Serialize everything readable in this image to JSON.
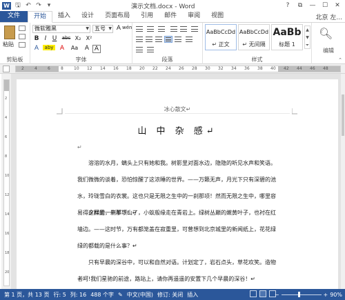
{
  "titlebar": {
    "app_icon": "W",
    "title": "演示文档.docx - Word",
    "qat": [
      "save-icon",
      "undo-icon",
      "redo-icon",
      "customize-icon"
    ],
    "controls": [
      "?",
      "⧉",
      "—",
      "☐",
      "✕"
    ]
  },
  "tabs": {
    "file": "文件",
    "items": [
      "开始",
      "插入",
      "设计",
      "页面布局",
      "引用",
      "邮件",
      "审阅",
      "视图"
    ],
    "active": "开始",
    "user": "北京 左..."
  },
  "ribbon": {
    "clipboard": {
      "paste": "粘贴",
      "label": "剪贴板"
    },
    "font": {
      "name": "微软雅黑",
      "size": "五号",
      "wen_button": "wén",
      "a_button": "A",
      "buttons_row2": [
        "B",
        "I",
        "U",
        "abc",
        "X₂",
        "X²"
      ],
      "buttons_row3": [
        "A",
        "aby",
        "A",
        "Aa",
        "A",
        "A"
      ],
      "label": "字体"
    },
    "paragraph": {
      "label": "段落"
    },
    "styles": {
      "items": [
        {
          "sample": "AaBbCcDd",
          "name": "↵ 正文"
        },
        {
          "sample": "AaBbCcDd",
          "name": "↵ 无间隔"
        },
        {
          "sample": "AaBb",
          "name": "标题 1"
        }
      ],
      "label": "样式"
    },
    "editing": {
      "label": "编辑"
    }
  },
  "ruler": {
    "numbers": [
      "2",
      "4",
      "6",
      "8",
      "10",
      "12",
      "14",
      "16",
      "18",
      "20",
      "22",
      "24",
      "26",
      "28",
      "30",
      "32",
      "34",
      "36",
      "38",
      "40",
      "42",
      "44",
      "46",
      "48"
    ]
  },
  "vruler": {
    "numbers": [
      "2",
      "4",
      "6",
      "8",
      "10",
      "12",
      "14",
      "16",
      "18",
      "20"
    ]
  },
  "document": {
    "header": "冰心散文↵",
    "title": "山 中 杂 感↵",
    "para_mark": "↵",
    "paragraphs": [
      "　　溶溶的水月，螭头上只有她和我。树影里对面水边，隐隐的听见水声和笑语。我们微微的谈着，恐怕惊醒了这浓睡的世界。——万籁无声，月光下只有深碧的池水，玲珑雪白的衣裳。这也只是无限之生中的一刹那顷！然而无限之生中，哪里容易得这样的一刹那顷！↵",
      "　　夕照里，牛羊下山了，小蚁般缘走在青岩上。绿树丛巅的嫩黄叶子，也衬在红墙边。——这时节，万有都笼盖在寂重里，可曾想到北京城里的新闻纸上，花花绿绿的都载的是什么事？↵",
      "　　只有早晨的深谷中，可以和自然对语。计划定了，岩石点头，草花欢笑。造物者呵!我们星驰的前途，路站上，请你再遥遥的安置下几个早晨的深谷！↵"
    ]
  },
  "statusbar": {
    "page": "第 1 页，共 13 页",
    "line": "行: 5",
    "column": "列: 16",
    "words": "488 个字",
    "language": "中文(中国)",
    "revision": "修订: 关闭",
    "mode": "插入",
    "zoom": "90%",
    "zoom_level": 0.9
  }
}
